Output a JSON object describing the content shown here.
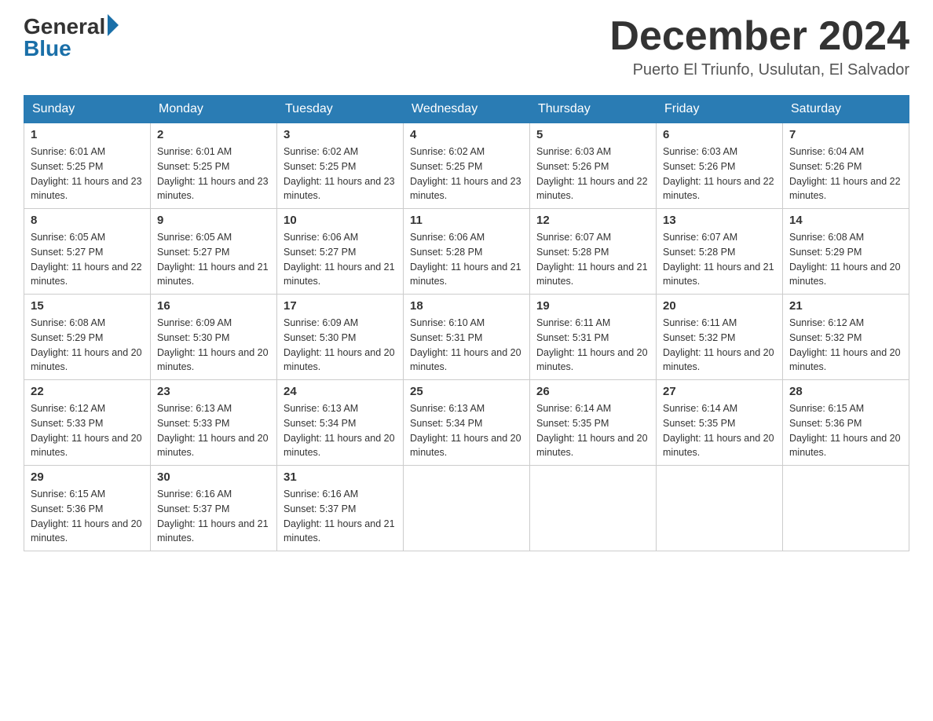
{
  "header": {
    "logo_general": "General",
    "logo_blue": "Blue",
    "month_year": "December 2024",
    "location": "Puerto El Triunfo, Usulutan, El Salvador"
  },
  "calendar": {
    "days_of_week": [
      "Sunday",
      "Monday",
      "Tuesday",
      "Wednesday",
      "Thursday",
      "Friday",
      "Saturday"
    ],
    "weeks": [
      [
        {
          "date": "1",
          "sunrise": "Sunrise: 6:01 AM",
          "sunset": "Sunset: 5:25 PM",
          "daylight": "Daylight: 11 hours and 23 minutes."
        },
        {
          "date": "2",
          "sunrise": "Sunrise: 6:01 AM",
          "sunset": "Sunset: 5:25 PM",
          "daylight": "Daylight: 11 hours and 23 minutes."
        },
        {
          "date": "3",
          "sunrise": "Sunrise: 6:02 AM",
          "sunset": "Sunset: 5:25 PM",
          "daylight": "Daylight: 11 hours and 23 minutes."
        },
        {
          "date": "4",
          "sunrise": "Sunrise: 6:02 AM",
          "sunset": "Sunset: 5:25 PM",
          "daylight": "Daylight: 11 hours and 23 minutes."
        },
        {
          "date": "5",
          "sunrise": "Sunrise: 6:03 AM",
          "sunset": "Sunset: 5:26 PM",
          "daylight": "Daylight: 11 hours and 22 minutes."
        },
        {
          "date": "6",
          "sunrise": "Sunrise: 6:03 AM",
          "sunset": "Sunset: 5:26 PM",
          "daylight": "Daylight: 11 hours and 22 minutes."
        },
        {
          "date": "7",
          "sunrise": "Sunrise: 6:04 AM",
          "sunset": "Sunset: 5:26 PM",
          "daylight": "Daylight: 11 hours and 22 minutes."
        }
      ],
      [
        {
          "date": "8",
          "sunrise": "Sunrise: 6:05 AM",
          "sunset": "Sunset: 5:27 PM",
          "daylight": "Daylight: 11 hours and 22 minutes."
        },
        {
          "date": "9",
          "sunrise": "Sunrise: 6:05 AM",
          "sunset": "Sunset: 5:27 PM",
          "daylight": "Daylight: 11 hours and 21 minutes."
        },
        {
          "date": "10",
          "sunrise": "Sunrise: 6:06 AM",
          "sunset": "Sunset: 5:27 PM",
          "daylight": "Daylight: 11 hours and 21 minutes."
        },
        {
          "date": "11",
          "sunrise": "Sunrise: 6:06 AM",
          "sunset": "Sunset: 5:28 PM",
          "daylight": "Daylight: 11 hours and 21 minutes."
        },
        {
          "date": "12",
          "sunrise": "Sunrise: 6:07 AM",
          "sunset": "Sunset: 5:28 PM",
          "daylight": "Daylight: 11 hours and 21 minutes."
        },
        {
          "date": "13",
          "sunrise": "Sunrise: 6:07 AM",
          "sunset": "Sunset: 5:28 PM",
          "daylight": "Daylight: 11 hours and 21 minutes."
        },
        {
          "date": "14",
          "sunrise": "Sunrise: 6:08 AM",
          "sunset": "Sunset: 5:29 PM",
          "daylight": "Daylight: 11 hours and 20 minutes."
        }
      ],
      [
        {
          "date": "15",
          "sunrise": "Sunrise: 6:08 AM",
          "sunset": "Sunset: 5:29 PM",
          "daylight": "Daylight: 11 hours and 20 minutes."
        },
        {
          "date": "16",
          "sunrise": "Sunrise: 6:09 AM",
          "sunset": "Sunset: 5:30 PM",
          "daylight": "Daylight: 11 hours and 20 minutes."
        },
        {
          "date": "17",
          "sunrise": "Sunrise: 6:09 AM",
          "sunset": "Sunset: 5:30 PM",
          "daylight": "Daylight: 11 hours and 20 minutes."
        },
        {
          "date": "18",
          "sunrise": "Sunrise: 6:10 AM",
          "sunset": "Sunset: 5:31 PM",
          "daylight": "Daylight: 11 hours and 20 minutes."
        },
        {
          "date": "19",
          "sunrise": "Sunrise: 6:11 AM",
          "sunset": "Sunset: 5:31 PM",
          "daylight": "Daylight: 11 hours and 20 minutes."
        },
        {
          "date": "20",
          "sunrise": "Sunrise: 6:11 AM",
          "sunset": "Sunset: 5:32 PM",
          "daylight": "Daylight: 11 hours and 20 minutes."
        },
        {
          "date": "21",
          "sunrise": "Sunrise: 6:12 AM",
          "sunset": "Sunset: 5:32 PM",
          "daylight": "Daylight: 11 hours and 20 minutes."
        }
      ],
      [
        {
          "date": "22",
          "sunrise": "Sunrise: 6:12 AM",
          "sunset": "Sunset: 5:33 PM",
          "daylight": "Daylight: 11 hours and 20 minutes."
        },
        {
          "date": "23",
          "sunrise": "Sunrise: 6:13 AM",
          "sunset": "Sunset: 5:33 PM",
          "daylight": "Daylight: 11 hours and 20 minutes."
        },
        {
          "date": "24",
          "sunrise": "Sunrise: 6:13 AM",
          "sunset": "Sunset: 5:34 PM",
          "daylight": "Daylight: 11 hours and 20 minutes."
        },
        {
          "date": "25",
          "sunrise": "Sunrise: 6:13 AM",
          "sunset": "Sunset: 5:34 PM",
          "daylight": "Daylight: 11 hours and 20 minutes."
        },
        {
          "date": "26",
          "sunrise": "Sunrise: 6:14 AM",
          "sunset": "Sunset: 5:35 PM",
          "daylight": "Daylight: 11 hours and 20 minutes."
        },
        {
          "date": "27",
          "sunrise": "Sunrise: 6:14 AM",
          "sunset": "Sunset: 5:35 PM",
          "daylight": "Daylight: 11 hours and 20 minutes."
        },
        {
          "date": "28",
          "sunrise": "Sunrise: 6:15 AM",
          "sunset": "Sunset: 5:36 PM",
          "daylight": "Daylight: 11 hours and 20 minutes."
        }
      ],
      [
        {
          "date": "29",
          "sunrise": "Sunrise: 6:15 AM",
          "sunset": "Sunset: 5:36 PM",
          "daylight": "Daylight: 11 hours and 20 minutes."
        },
        {
          "date": "30",
          "sunrise": "Sunrise: 6:16 AM",
          "sunset": "Sunset: 5:37 PM",
          "daylight": "Daylight: 11 hours and 21 minutes."
        },
        {
          "date": "31",
          "sunrise": "Sunrise: 6:16 AM",
          "sunset": "Sunset: 5:37 PM",
          "daylight": "Daylight: 11 hours and 21 minutes."
        },
        {
          "date": "",
          "sunrise": "",
          "sunset": "",
          "daylight": ""
        },
        {
          "date": "",
          "sunrise": "",
          "sunset": "",
          "daylight": ""
        },
        {
          "date": "",
          "sunrise": "",
          "sunset": "",
          "daylight": ""
        },
        {
          "date": "",
          "sunrise": "",
          "sunset": "",
          "daylight": ""
        }
      ]
    ]
  }
}
